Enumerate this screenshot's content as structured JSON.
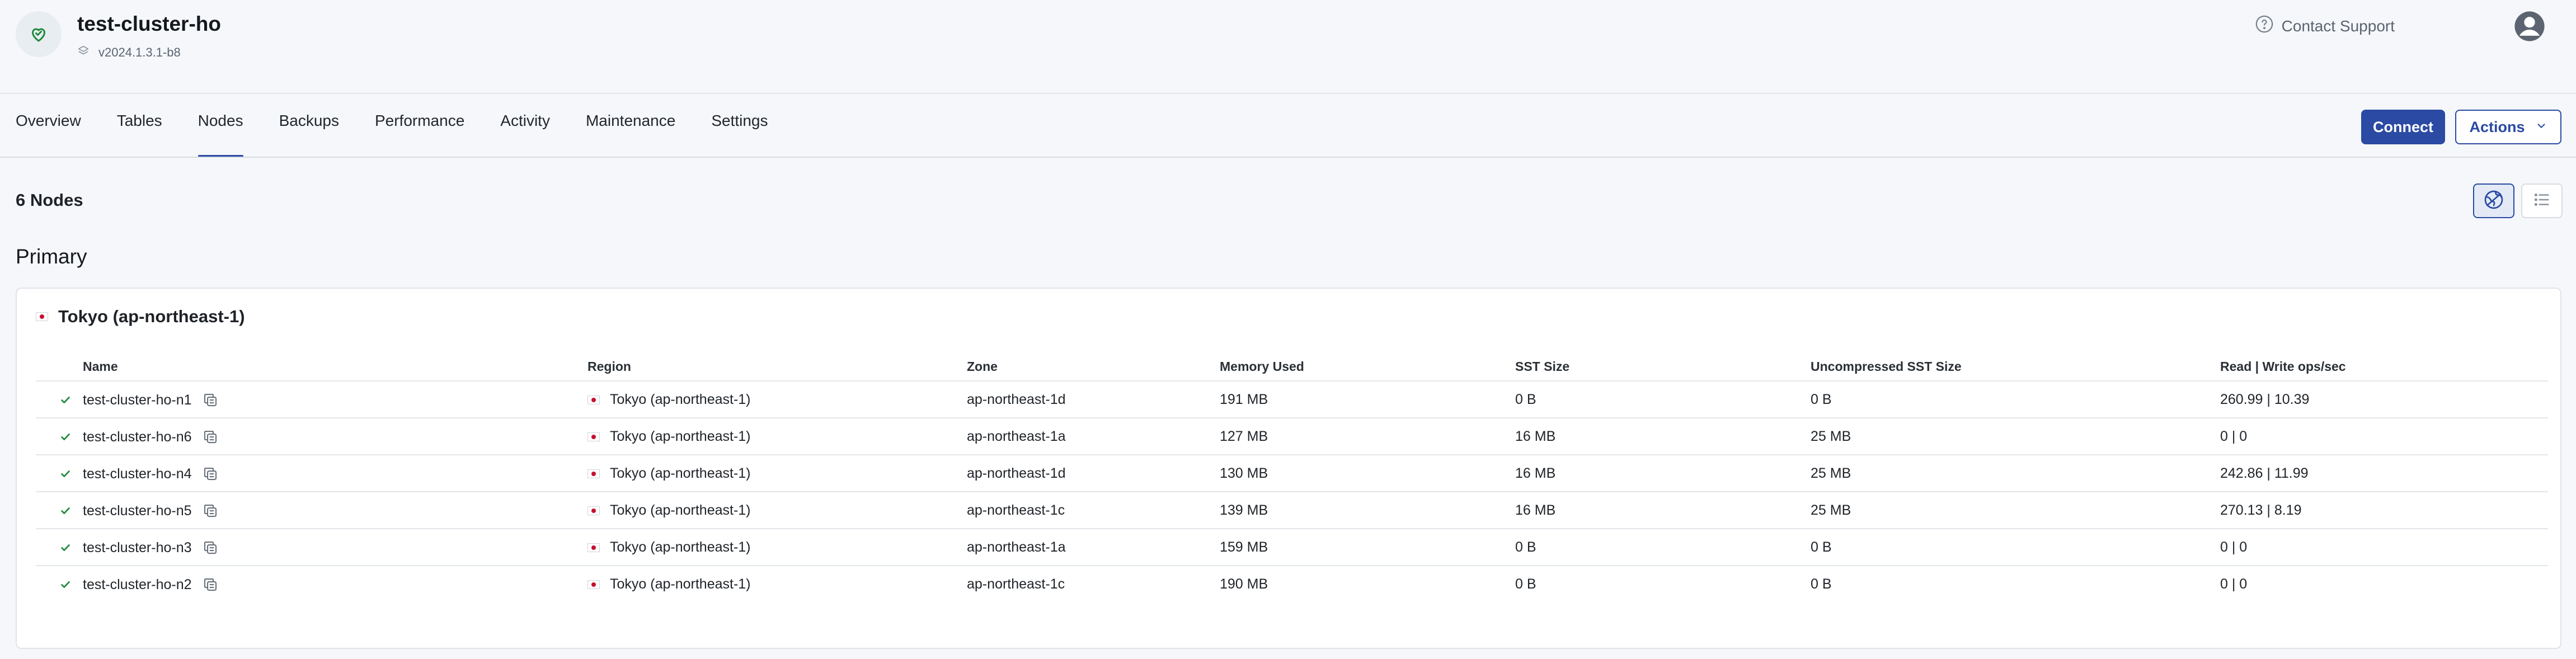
{
  "header": {
    "cluster_name": "test-cluster-ho",
    "version": "v2024.1.3.1-b8",
    "support_label": "Contact Support",
    "cluster_icon": "heart-check-icon",
    "version_icon": "stack-icon",
    "avatar_icon": "user-avatar-icon"
  },
  "tabs": [
    {
      "label": "Overview",
      "active": false
    },
    {
      "label": "Tables",
      "active": false
    },
    {
      "label": "Nodes",
      "active": true
    },
    {
      "label": "Backups",
      "active": false
    },
    {
      "label": "Performance",
      "active": false
    },
    {
      "label": "Activity",
      "active": false
    },
    {
      "label": "Maintenance",
      "active": false
    },
    {
      "label": "Settings",
      "active": false
    }
  ],
  "toolbar": {
    "connect_label": "Connect",
    "actions_label": "Actions"
  },
  "nodes": {
    "count_label": "6 Nodes",
    "section_title": "Primary",
    "view_modes": [
      "map-view-icon",
      "list-view-icon"
    ],
    "active_view": "map"
  },
  "region": {
    "title": "Tokyo (ap-northeast-1)",
    "columns": [
      "Name",
      "Region",
      "Zone",
      "Memory Used",
      "SST Size",
      "Uncompressed SST Size",
      "Read | Write ops/sec"
    ],
    "rows": [
      {
        "name": "test-cluster-ho-n1",
        "region": "Tokyo (ap-northeast-1)",
        "zone": "ap-northeast-1d",
        "memory": "191 MB",
        "sst": "0 B",
        "usst": "0 B",
        "rw": "260.99 | 10.39"
      },
      {
        "name": "test-cluster-ho-n6",
        "region": "Tokyo (ap-northeast-1)",
        "zone": "ap-northeast-1a",
        "memory": "127 MB",
        "sst": "16 MB",
        "usst": "25 MB",
        "rw": "0 | 0"
      },
      {
        "name": "test-cluster-ho-n4",
        "region": "Tokyo (ap-northeast-1)",
        "zone": "ap-northeast-1d",
        "memory": "130 MB",
        "sst": "16 MB",
        "usst": "25 MB",
        "rw": "242.86 | 11.99"
      },
      {
        "name": "test-cluster-ho-n5",
        "region": "Tokyo (ap-northeast-1)",
        "zone": "ap-northeast-1c",
        "memory": "139 MB",
        "sst": "16 MB",
        "usst": "25 MB",
        "rw": "270.13 | 8.19"
      },
      {
        "name": "test-cluster-ho-n3",
        "region": "Tokyo (ap-northeast-1)",
        "zone": "ap-northeast-1a",
        "memory": "159 MB",
        "sst": "0 B",
        "usst": "0 B",
        "rw": "0 | 0"
      },
      {
        "name": "test-cluster-ho-n2",
        "region": "Tokyo (ap-northeast-1)",
        "zone": "ap-northeast-1c",
        "memory": "190 MB",
        "sst": "0 B",
        "usst": "0 B",
        "rw": "0 | 0"
      }
    ]
  },
  "colors": {
    "accent": "#2a4aa3",
    "status_ok": "#1f8a3b",
    "page_bg": "#f5f7fa"
  }
}
